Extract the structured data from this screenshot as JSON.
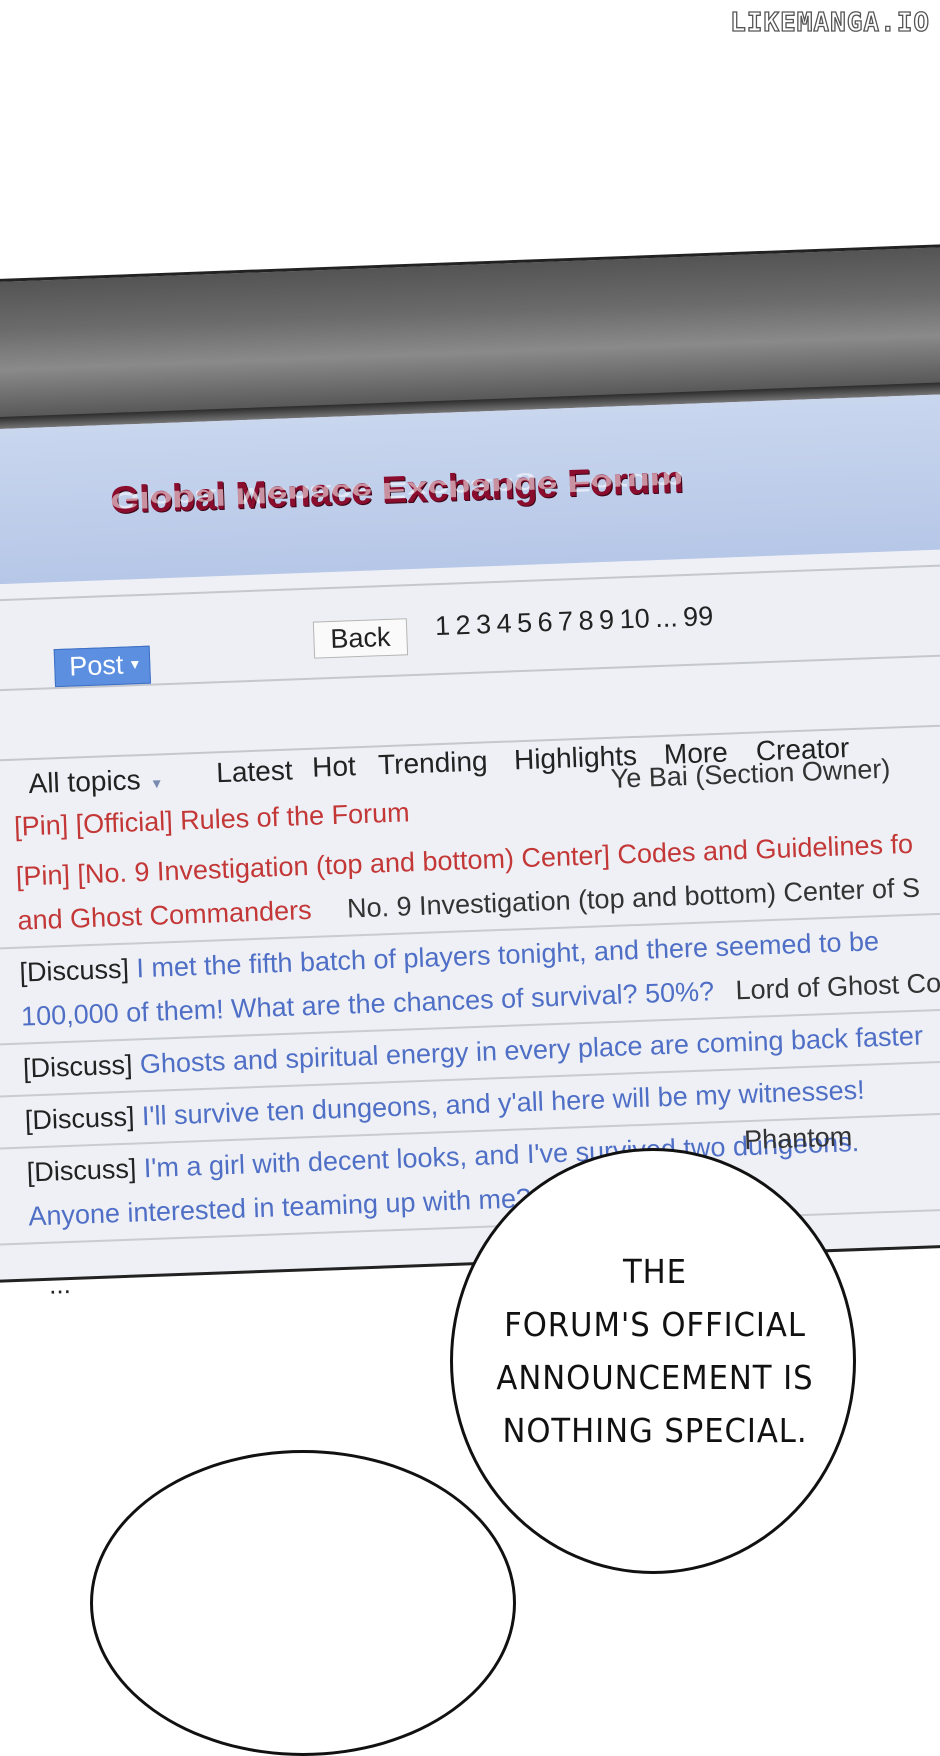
{
  "watermark": "LIKEMANGA.IO",
  "forum": {
    "title": "Global Menace Exchange Forum"
  },
  "toolbar": {
    "post_label": "Post",
    "post_caret": "▾",
    "back_label": "Back",
    "pages": "1 2 3 4 5 6 7 8 9 10 ... 99"
  },
  "tabs": {
    "all_topics": "All topics",
    "all_topics_caret": "▾",
    "latest": "Latest",
    "hot": "Hot",
    "trending": "Trending",
    "highlights": "Highlights",
    "more": "More",
    "creator": "Creator"
  },
  "threads": [
    {
      "tags": [
        "[Pin]",
        "[Official]"
      ],
      "title": "Rules of the Forum",
      "author": "Ye Bai (Section Owner)"
    },
    {
      "tag": "[Pin]",
      "category": "[No. 9 Investigation (top and bottom) Center]",
      "title_line1": "Codes and Guidelines fo",
      "title_line2": "and Ghost Commanders",
      "author": "No. 9 Investigation (top and bottom) Center of S"
    },
    {
      "tag": "[Discuss]",
      "title_line1": "I met the fifth batch of players tonight, and there seemed to be",
      "title_line2": "100,000 of them! What are the chances of survival? 50%?",
      "author": "Lord of Ghost Co"
    },
    {
      "tag": "[Discuss]",
      "title": "Ghosts and spiritual energy in every place are coming back faster"
    },
    {
      "tag": "[Discuss]",
      "title": "I'll survive ten dungeons, and y'all here will be my witnesses!"
    },
    {
      "tag": "[Discuss]",
      "title_line1": "I'm a girl with decent looks, and I've survived two dungeons.",
      "title_line2": "Anyone interested in teaming up with me?",
      "author": "Phantom"
    }
  ],
  "more_indicator": "...",
  "bubble": {
    "line1": "THE",
    "line2": "FORUM'S OFFICIAL",
    "line3": "ANNOUNCEMENT IS",
    "line4": "NOTHING SPECIAL."
  }
}
